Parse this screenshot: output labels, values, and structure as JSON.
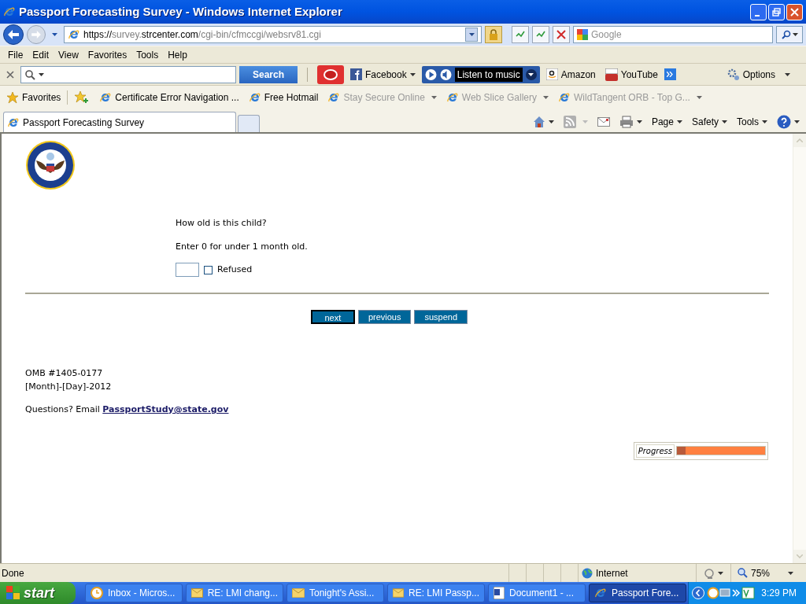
{
  "window": {
    "title": "Passport Forecasting Survey - Windows Internet Explorer"
  },
  "address": {
    "url_parts": [
      {
        "text": "https://",
        "strong": true
      },
      {
        "text": "survey.",
        "strong": false
      },
      {
        "text": "strcenter.com",
        "strong": true
      },
      {
        "text": "/cgi-bin/cfmccgi/websrv81.cgi",
        "strong": false
      }
    ],
    "search_placeholder": "Google"
  },
  "menu": [
    "File",
    "Edit",
    "View",
    "Favorites",
    "Tools",
    "Help"
  ],
  "toolbar": {
    "search_button": "Search",
    "items": [
      {
        "kind": "facebook",
        "label": "Facebook"
      },
      {
        "kind": "music",
        "label": "Listen to music"
      },
      {
        "kind": "amazon",
        "label": "Amazon"
      },
      {
        "kind": "youtube",
        "label": "YouTube"
      }
    ],
    "options": "Options"
  },
  "favorites_bar": {
    "label": "Favorites",
    "links": [
      {
        "label": "Certificate Error Navigation ...",
        "dimmed": false,
        "dropdown": false
      },
      {
        "label": "Free Hotmail",
        "dimmed": false,
        "dropdown": false
      },
      {
        "label": "Stay Secure Online",
        "dimmed": true,
        "dropdown": true
      },
      {
        "label": "Web Slice Gallery",
        "dimmed": true,
        "dropdown": true
      },
      {
        "label": "WildTangent ORB - Top G...",
        "dimmed": true,
        "dropdown": true
      }
    ]
  },
  "tabs": [
    {
      "label": "Passport Forecasting Survey",
      "selected": true
    }
  ],
  "command_bar": [
    "Page",
    "Safety",
    "Tools"
  ],
  "survey": {
    "question": "How old is this child?",
    "hint": "Enter 0 for under 1 month old.",
    "refused": {
      "label": "Refused",
      "checked": false
    },
    "buttons": [
      {
        "label": "next",
        "focused": true
      },
      {
        "label": "previous",
        "focused": false
      },
      {
        "label": "suspend",
        "focused": false
      }
    ],
    "omb": "OMB #1405-0177",
    "date": "[Month]-[Day]-2012",
    "questions": "Questions? Email ",
    "email": "PassportStudy@state.gov",
    "progress": {
      "label": "Progress",
      "level": 0.1
    }
  },
  "status_bar": {
    "text": "Done",
    "zone": "Internet",
    "zoom": "75%"
  },
  "taskbar": {
    "start": "start",
    "tasks": [
      {
        "kind": "outlook",
        "label": "Inbox - Micros...",
        "selected": false
      },
      {
        "kind": "mail",
        "label": "RE: LMI chang...",
        "selected": false
      },
      {
        "kind": "mail",
        "label": "Tonight's Assi...",
        "selected": false
      },
      {
        "kind": "mail",
        "label": "RE: LMI Passp...",
        "selected": false
      },
      {
        "kind": "word",
        "label": "Document1 - ...",
        "selected": false
      },
      {
        "kind": "ie",
        "label": "Passport Fore...",
        "selected": true
      }
    ],
    "clock": "3:29 PM"
  }
}
